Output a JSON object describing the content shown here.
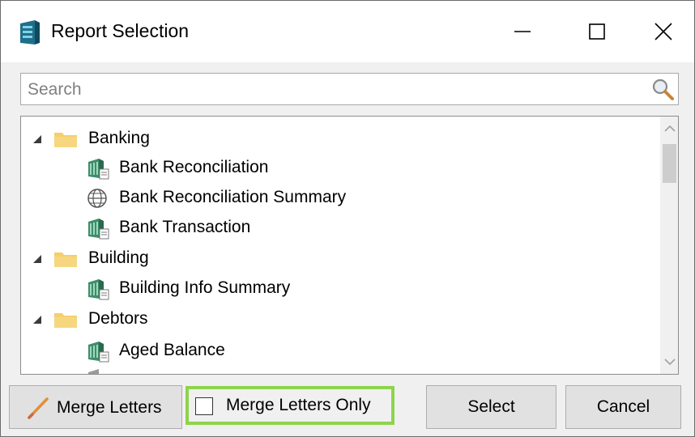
{
  "window": {
    "title": "Report Selection",
    "icon": "database-report-icon"
  },
  "search": {
    "placeholder": "Search",
    "value": ""
  },
  "tree": [
    {
      "type": "group",
      "label": "Banking",
      "expanded": true,
      "icon": "folder-icon"
    },
    {
      "type": "report",
      "label": "Bank Reconciliation",
      "icon": "report-icon"
    },
    {
      "type": "report",
      "label": "Bank Reconciliation Summary",
      "icon": "globe-icon"
    },
    {
      "type": "report",
      "label": "Bank Transaction",
      "icon": "report-icon"
    },
    {
      "type": "group",
      "label": "Building",
      "expanded": true,
      "icon": "folder-icon"
    },
    {
      "type": "report",
      "label": "Building Info Summary",
      "icon": "report-icon"
    },
    {
      "type": "group",
      "label": "Debtors",
      "expanded": true,
      "icon": "folder-icon"
    },
    {
      "type": "report",
      "label": "Aged Balance",
      "icon": "report-icon"
    }
  ],
  "footer": {
    "merge_letters_label": "Merge Letters",
    "merge_letters_only_label": "Merge Letters Only",
    "merge_letters_only_checked": false,
    "select_label": "Select",
    "cancel_label": "Cancel",
    "highlight_color": "#8ed44b"
  },
  "colors": {
    "folder": "#f4cf6e",
    "report_icon": "#3f8d6b"
  }
}
